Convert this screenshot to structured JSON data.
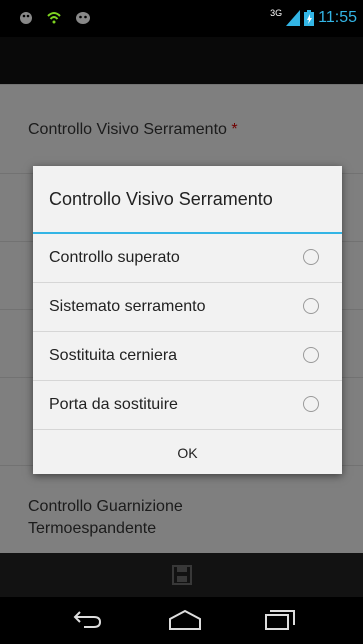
{
  "status_bar": {
    "time": "11:55",
    "network": "3G",
    "left_icons": [
      "android-icon",
      "wifi-icon",
      "android-icon"
    ]
  },
  "form": {
    "fields": [
      {
        "label": "Controllo Visivo Serramento",
        "required_mark": "*"
      },
      {
        "label": "Controllo Guarnizione\nTermoespandente",
        "required_mark": ""
      }
    ]
  },
  "dialog": {
    "title": "Controllo Visivo Serramento",
    "options": [
      {
        "label": "Controllo superato",
        "selected": false
      },
      {
        "label": "Sistemato serramento",
        "selected": false
      },
      {
        "label": "Sostituita cerniera",
        "selected": false
      },
      {
        "label": "Porta da sostituire",
        "selected": false
      }
    ],
    "ok_label": "OK"
  },
  "bottom_bar": {
    "save_icon": "save-icon"
  },
  "nav_bar": {
    "icons": [
      "back-icon",
      "home-icon",
      "recents-icon"
    ]
  },
  "colors": {
    "accent": "#33b5e5",
    "required": "#cc0000"
  }
}
